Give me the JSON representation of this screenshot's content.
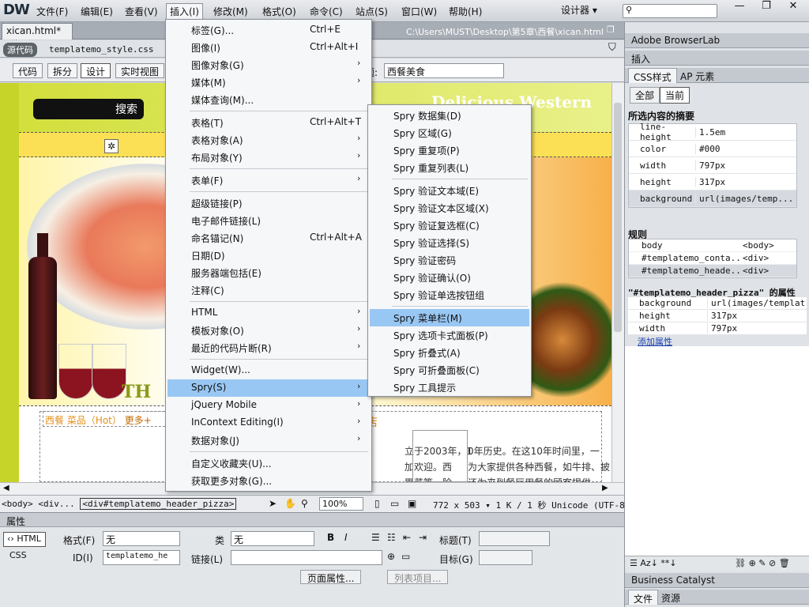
{
  "app": {
    "logo": "DW"
  },
  "menubar": {
    "items": [
      "文件(F)",
      "编辑(E)",
      "查看(V)",
      "插入(I)",
      "修改(M)",
      "格式(O)",
      "命令(C)",
      "站点(S)",
      "窗口(W)",
      "帮助(H)"
    ],
    "workspace": "设计器 ▾",
    "window_controls": [
      "—",
      "❐",
      "✕"
    ]
  },
  "document": {
    "tab_label": "xican.html*",
    "path": "C:\\Users\\MUST\\Desktop\\第5章\\西餐\\xican.html",
    "source_badge": "源代码",
    "related_file": "templatemo_style.css"
  },
  "view_buttons": [
    "代码",
    "拆分",
    "设计",
    "实时视图"
  ],
  "title_field": {
    "label": "题:",
    "value": "西餐美食"
  },
  "canvas": {
    "search_button": "搜索",
    "headline": "Delicious Western",
    "headline_sub": "n",
    "th_text": "TH",
    "hot_label": "西餐 菜品（Hot）",
    "hot_more": "更多+",
    "red_char": "店",
    "body_text_1": "立于2003年，1",
    "body_text_1b": "0年历史。在这10年时间里，一",
    "body_text_2": "加欢迎。西",
    "body_text_2b": "为大家提供各种西餐，如牛排、披",
    "body_text_3": "胃菜等。除",
    "body_text_3b": "还为来到餐厅用餐的顾客提供"
  },
  "statusbar": {
    "tags": [
      "<body>",
      "<div...",
      "<div#templatemo_header_pizza>"
    ],
    "zoom": "100%",
    "dims": "772 x 503 ▾  1 K / 1 秒  Unicode (UTF-8)"
  },
  "properties": {
    "header": "属性",
    "html_btn": "HTML",
    "css_btn": "CSS",
    "format_label": "格式(F)",
    "format_value": "无",
    "class_label": "类",
    "class_value": "无",
    "bold": "B",
    "italic": "I",
    "title_label": "标题(T)",
    "id_label": "ID(I)",
    "id_value": "templatemo_he",
    "link_label": "链接(L)",
    "target_label": "目标(G)",
    "page_props": "页面属性...",
    "list_item": "列表项目..."
  },
  "right_panel": {
    "browserlab": "Adobe BrowserLab",
    "insert": "插入",
    "css_tab": "CSS样式",
    "ap_tab": "AP 元素",
    "all_btn": "全部",
    "current_btn": "当前",
    "summary_title": "所选内容的摘要",
    "summary": [
      {
        "k": "line-height",
        "v": "1.5em"
      },
      {
        "k": "color",
        "v": "#000"
      },
      {
        "k": "width",
        "v": "797px"
      },
      {
        "k": "height",
        "v": "317px"
      },
      {
        "k": "background",
        "v": "url(images/temp..."
      }
    ],
    "rules_title": "规则",
    "rules": [
      {
        "k": "body",
        "v": "<body>"
      },
      {
        "k": "#templatemo_conta...",
        "v": "<div>"
      },
      {
        "k": "#templatemo_heade...",
        "v": "<div>"
      }
    ],
    "props_title": "\"#templatemo_header_pizza\" 的属性",
    "props": [
      {
        "k": "background",
        "v": "url(images/templat..."
      },
      {
        "k": "height",
        "v": "317px"
      },
      {
        "k": "width",
        "v": "797px"
      }
    ],
    "add_prop": "添加属性",
    "bc": "Business Catalyst",
    "files": "文件",
    "assets": "资源"
  },
  "insert_menu": [
    {
      "label": "标签(G)...",
      "shortcut": "Ctrl+E"
    },
    {
      "label": "图像(I)",
      "shortcut": "Ctrl+Alt+I"
    },
    {
      "label": "图像对象(G)",
      "arrow": true
    },
    {
      "label": "媒体(M)",
      "arrow": true
    },
    {
      "label": "媒体查询(M)..."
    },
    {
      "sep": true
    },
    {
      "label": "表格(T)",
      "shortcut": "Ctrl+Alt+T"
    },
    {
      "label": "表格对象(A)",
      "arrow": true
    },
    {
      "label": "布局对象(Y)",
      "arrow": true
    },
    {
      "sep": true
    },
    {
      "label": "表单(F)",
      "arrow": true
    },
    {
      "sep": true
    },
    {
      "label": "超级链接(P)"
    },
    {
      "label": "电子邮件链接(L)"
    },
    {
      "label": "命名锚记(N)",
      "shortcut": "Ctrl+Alt+A"
    },
    {
      "label": "日期(D)"
    },
    {
      "label": "服务器端包括(E)"
    },
    {
      "label": "注释(C)"
    },
    {
      "sep": true
    },
    {
      "label": "HTML",
      "arrow": true
    },
    {
      "label": "模板对象(O)",
      "arrow": true
    },
    {
      "label": "最近的代码片断(R)",
      "arrow": true
    },
    {
      "sep": true
    },
    {
      "label": "Widget(W)..."
    },
    {
      "label": "Spry(S)",
      "arrow": true,
      "highlight": true
    },
    {
      "label": "jQuery Mobile",
      "arrow": true
    },
    {
      "label": "InContext Editing(I)",
      "arrow": true
    },
    {
      "label": "数据对象(J)",
      "arrow": true
    },
    {
      "sep": true
    },
    {
      "label": "自定义收藏夹(U)..."
    },
    {
      "label": "获取更多对象(G)..."
    }
  ],
  "spry_menu": [
    {
      "label": "Spry 数据集(D)"
    },
    {
      "label": "Spry 区域(G)"
    },
    {
      "label": "Spry 重复项(P)"
    },
    {
      "label": "Spry 重复列表(L)"
    },
    {
      "sep": true
    },
    {
      "label": "Spry 验证文本域(E)"
    },
    {
      "label": "Spry 验证文本区域(X)"
    },
    {
      "label": "Spry 验证复选框(C)"
    },
    {
      "label": "Spry 验证选择(S)"
    },
    {
      "label": "Spry 验证密码"
    },
    {
      "label": "Spry 验证确认(O)"
    },
    {
      "label": "Spry 验证单选按钮组"
    },
    {
      "sep": true
    },
    {
      "label": "Spry 菜单栏(M)",
      "highlight": true
    },
    {
      "label": "Spry 选项卡式面板(P)"
    },
    {
      "label": "Spry 折叠式(A)"
    },
    {
      "label": "Spry 可折叠面板(C)"
    },
    {
      "label": "Spry 工具提示"
    }
  ]
}
